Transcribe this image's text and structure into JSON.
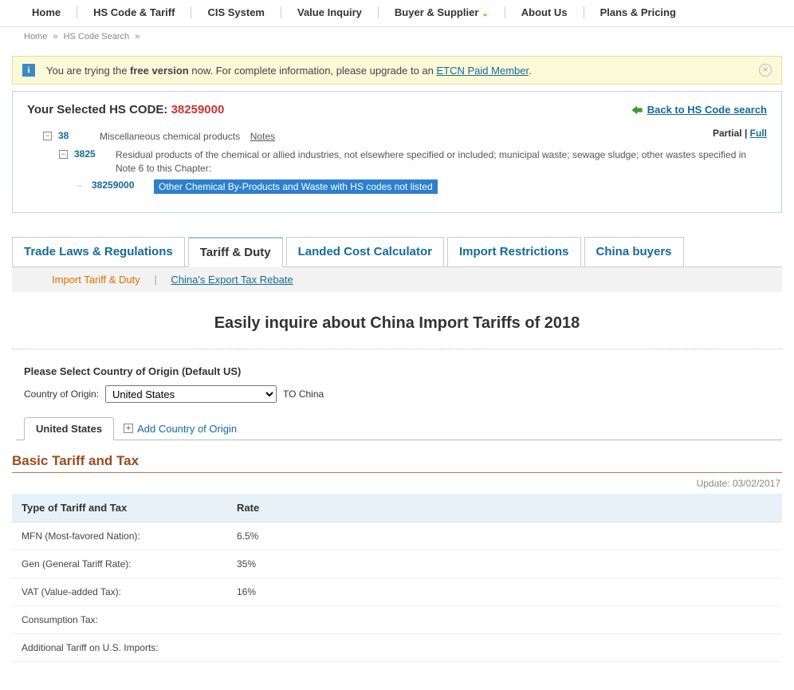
{
  "nav": {
    "items": [
      "Home",
      "HS Code & Tariff",
      "CIS System",
      "Value Inquiry",
      "Buyer & Supplier",
      "About Us",
      "Plans & Pricing"
    ],
    "dropdown_index": 4
  },
  "breadcrumb": {
    "items": [
      "Home",
      "HS Code Search",
      ""
    ],
    "sep": "»"
  },
  "alert": {
    "prefix": "You are trying the ",
    "bold": "free version",
    "middle": " now. For complete information, please upgrade to an ",
    "link": "ETCN Paid Member",
    "suffix": "."
  },
  "selected": {
    "label": "Your Selected HS CODE: ",
    "code": "38259000",
    "back": "Back to HS Code search",
    "partial": "Partial",
    "full": "Full",
    "sep": " | ",
    "tree": {
      "l1_code": "38",
      "l1_desc": "Miscellaneous chemical products",
      "l1_notes": "Notes",
      "l2_code": "3825",
      "l2_desc": "Residual products of the chemical or allied industries, not elsewhere specified or included; municipal waste; sewage sludge; other wastes specified in Note 6 to this Chapter:",
      "l3_code": "38259000",
      "l3_desc": "Other Chemical By-Products and Waste with HS codes not listed"
    }
  },
  "main_tabs": [
    "Trade Laws & Regulations",
    "Tariff & Duty",
    "Landed Cost Calculator",
    "Import Restrictions",
    "China buyers"
  ],
  "main_tabs_active": 1,
  "sub_nav": {
    "active": "Import Tariff & Duty",
    "sep": "|",
    "link": "China's Export Tax Rebate"
  },
  "heading": "Easily inquire about China Import Tariffs of 2018",
  "origin": {
    "hint": "Please Select Country of Origin (Default US)",
    "label": "Country of Origin:",
    "selected": "United States",
    "to": "TO China"
  },
  "country_tabs": {
    "tab": "United States",
    "add": "Add Country of Origin"
  },
  "tariff": {
    "title": "Basic Tariff and Tax",
    "update_label": "Update: ",
    "update_date": "03/02/2017",
    "col1": "Type of Tariff and Tax",
    "col2": "Rate",
    "rows": [
      {
        "type": "MFN (Most-favored Nation):",
        "rate": "6.5%"
      },
      {
        "type": "Gen (General Tariff Rate):",
        "rate": "35%"
      },
      {
        "type": "VAT (Value-added Tax):",
        "rate": "16%"
      },
      {
        "type": "Consumption Tax:",
        "rate": ""
      },
      {
        "type": "Additional Tariff on U.S. Imports:",
        "rate": ""
      }
    ]
  }
}
